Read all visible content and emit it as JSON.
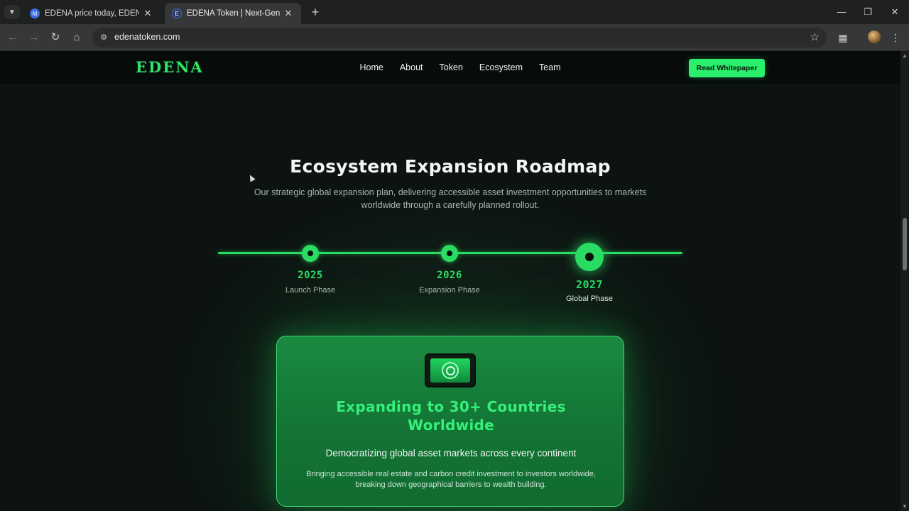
{
  "browser": {
    "tabs": [
      {
        "title": "EDENA price today, EDENA to U",
        "favicon": "coinmarketcap-icon",
        "active": false
      },
      {
        "title": "EDENA Token | Next-Generation",
        "favicon": "edena-icon",
        "active": true
      }
    ],
    "url": "edenatoken.com"
  },
  "site": {
    "logo": "EDENA",
    "nav": [
      "Home",
      "About",
      "Token",
      "Ecosystem",
      "Team"
    ],
    "cta": "Read Whitepaper"
  },
  "roadmap": {
    "title": "Ecosystem Expansion Roadmap",
    "subtitle": "Our strategic global expansion plan, delivering accessible asset investment opportunities to markets worldwide through a carefully planned rollout.",
    "milestones": [
      {
        "year": "2025",
        "phase": "Launch Phase",
        "active": false
      },
      {
        "year": "2026",
        "phase": "Expansion Phase",
        "active": false
      },
      {
        "year": "2027",
        "phase": "Global Phase",
        "active": true
      }
    ],
    "card": {
      "icon": "globe-target-icon",
      "title": "Expanding to 30+ Countries Worldwide",
      "subtitle": "Democratizing global asset markets across every continent",
      "body": "Bringing accessible real estate and carbon credit investment to investors worldwide, breaking down geographical barriers to wealth building."
    }
  },
  "colors": {
    "accent": "#2bdc63",
    "background": "#0c1311",
    "card": "#137435"
  }
}
